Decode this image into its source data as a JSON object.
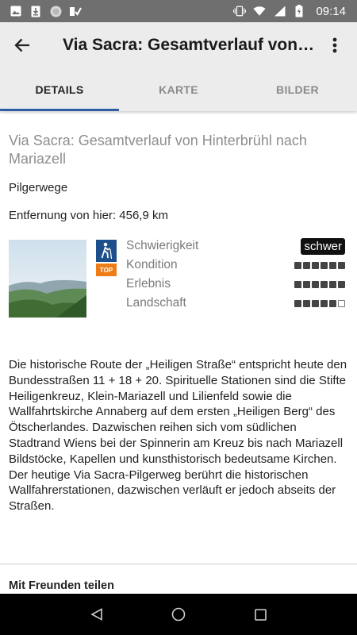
{
  "status_bar": {
    "time": "09:14",
    "left_icons": [
      "image-icon",
      "download-icon",
      "circle-icon",
      "checkmark-icon"
    ],
    "right_icons": [
      "vibrate-icon",
      "wifi-icon",
      "signal-icon",
      "battery-icon"
    ]
  },
  "appbar": {
    "title": "Via Sacra: Gesamtverlauf von Hinterbrühl nach Mariazell"
  },
  "tabs": [
    {
      "label": "DETAILS",
      "active": true
    },
    {
      "label": "KARTE",
      "active": false
    },
    {
      "label": "BILDER",
      "active": false
    }
  ],
  "detail": {
    "title": "Via Sacra: Gesamtverlauf von Hinterbrühl nach Mariazell",
    "category": "Pilgerwege",
    "distance": "Entfernung von hier: 456,9 km",
    "top_badge": "TOP",
    "ratings": {
      "difficulty_label": "Schwierigkeit",
      "difficulty_value": "schwer",
      "items": [
        {
          "label": "Kondition",
          "value": 6,
          "max": 6
        },
        {
          "label": "Erlebnis",
          "value": 6,
          "max": 6
        },
        {
          "label": "Landschaft",
          "value": 5,
          "max": 6
        }
      ]
    },
    "description_paragraphs": [
      "Die historische Route der „Heiligen Straße“ entspricht heute den Bundesstraßen 11 + 18 + 20. Spirituelle Stationen sind die Stifte Heiligenkreuz, Klein-Mariazell und Lilienfeld sowie die Wallfahrtskirche Annaberg auf dem ersten „Heiligen Berg“ des Ötscherlandes. Dazwischen reihen sich vom südlichen Stadtrand Wiens bei der Spinnerin am Kreuz bis nach Mariazell Bildstöcke, Kapellen und kunsthistorisch bedeutsame Kirchen.",
      "Der heutige Via Sacra-Pilgerweg berührt die historischen Wallfahrerstationen, dazwischen verläuft er jedoch abseits der Straßen."
    ],
    "share_title": "Mit Freunden teilen"
  },
  "colors": {
    "accent": "#2e5ea3",
    "hike_badge": "#1d4f8c",
    "top_badge": "#ef7d17"
  }
}
